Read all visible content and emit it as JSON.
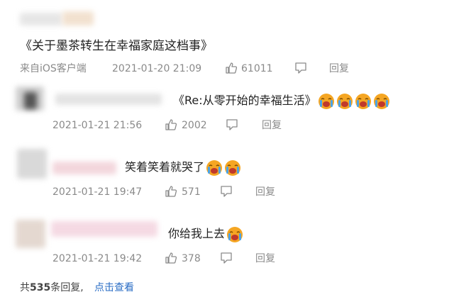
{
  "post": {
    "text": "《关于墨茶转生在幸福家庭这档事》",
    "source": "来自iOS客户端",
    "time": "2021-01-20 21:09",
    "likes": "61011",
    "reply_label": "回复"
  },
  "replies": [
    {
      "text": "《Re:从零开始的幸福生活》",
      "emoji": [
        "crying-face",
        "crying-face",
        "crying-face",
        "crying-face"
      ],
      "time": "2021-01-21 21:56",
      "likes": "2002",
      "reply_label": "回复"
    },
    {
      "text": "笑着笑着就哭了",
      "emoji": [
        "crying-face",
        "crying-face"
      ],
      "time": "2021-01-21 19:47",
      "likes": "571",
      "reply_label": "回复"
    },
    {
      "text": "你给我上去",
      "emoji": [
        "crying-face"
      ],
      "time": "2021-01-21 19:42",
      "likes": "378",
      "reply_label": "回复"
    }
  ],
  "footer": {
    "prefix": "共",
    "count": "535",
    "suffix": "条回复,",
    "link": "点击查看"
  },
  "colors": {
    "link": "#2a6dc5",
    "meta": "#8a8a8a",
    "emoji_face": "#f5a623",
    "emoji_mouth": "#c0392b",
    "emoji_tears": "#4aa3e8"
  }
}
